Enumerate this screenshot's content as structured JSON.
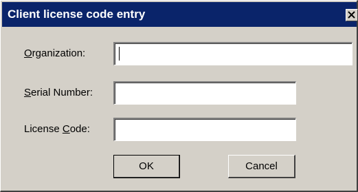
{
  "window": {
    "title": "Client license code entry",
    "close_icon": "close-x-icon",
    "titlebar_color": "#0a246a",
    "face_color": "#d4d0c8"
  },
  "form": {
    "organization": {
      "label_mnemonic": "O",
      "label_rest": "rganization:",
      "value": ""
    },
    "serial_number": {
      "label_mnemonic": "S",
      "label_rest": "erial Number:",
      "value": ""
    },
    "license_code": {
      "label_prefix": "License ",
      "label_mnemonic": "C",
      "label_rest": "ode:",
      "value": ""
    }
  },
  "buttons": {
    "ok_label": "OK",
    "cancel_label": "Cancel"
  }
}
